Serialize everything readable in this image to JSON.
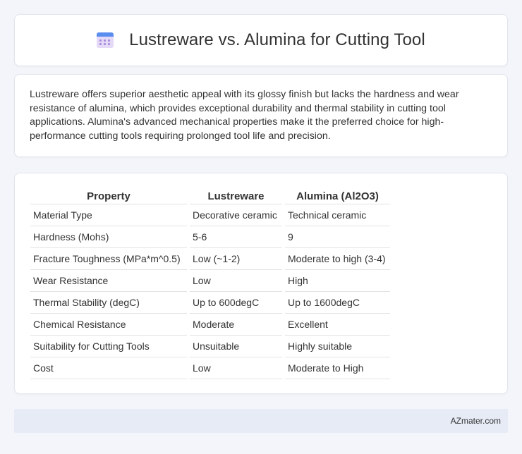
{
  "header": {
    "icon": "calendar-icon",
    "title": "Lustreware vs. Alumina for Cutting Tool"
  },
  "description": "Lustreware offers superior aesthetic appeal with its glossy finish but lacks the hardness and wear resistance of alumina, which provides exceptional durability and thermal stability in cutting tool applications. Alumina's advanced mechanical properties make it the preferred choice for high-performance cutting tools requiring prolonged tool life and precision.",
  "table": {
    "headers": [
      "Property",
      "Lustreware",
      "Alumina (Al2O3)"
    ],
    "rows": [
      [
        "Material Type",
        "Decorative ceramic",
        "Technical ceramic"
      ],
      [
        "Hardness (Mohs)",
        "5-6",
        "9"
      ],
      [
        "Fracture Toughness (MPa*m^0.5)",
        "Low (~1-2)",
        "Moderate to high (3-4)"
      ],
      [
        "Wear Resistance",
        "Low",
        "High"
      ],
      [
        "Thermal Stability (degC)",
        "Up to 600degC",
        "Up to 1600degC"
      ],
      [
        "Chemical Resistance",
        "Moderate",
        "Excellent"
      ],
      [
        "Suitability for Cutting Tools",
        "Unsuitable",
        "Highly suitable"
      ],
      [
        "Cost",
        "Low",
        "Moderate to High"
      ]
    ]
  },
  "footer": {
    "brand": "AZmater.com"
  }
}
